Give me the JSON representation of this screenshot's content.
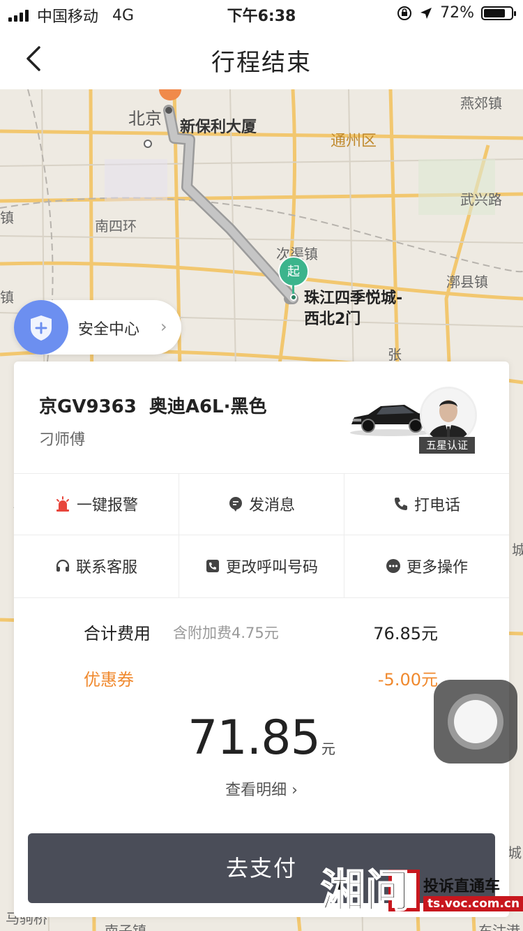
{
  "status_bar": {
    "carrier": "中国移动",
    "network": "4G",
    "time": "下午6:38",
    "battery": "72%"
  },
  "nav": {
    "title": "行程结束"
  },
  "map": {
    "labels": {
      "beijing": "北京",
      "xinbaoli": "新保利大厦",
      "tongzhou": "通州区",
      "yanjiao": "燕郊镇",
      "wuxing": "武兴路",
      "nansihuan": "南四环",
      "ciqu": "次渠镇",
      "xianxian": "漷县镇",
      "zhen_left": "镇",
      "zhen_left2": "镇",
      "zhang": "张",
      "cheng": "城",
      "dongcheng": "城",
      "majuqiao": "马驹桥",
      "nanzhen": "南子镇",
      "east": "东沽港"
    },
    "start_pin": "起",
    "destination": [
      "珠江四季悦城-",
      "西北2门"
    ]
  },
  "safety": {
    "label": "安全中心"
  },
  "driver": {
    "plate": "京GV9363",
    "car": "奥迪A6L·黑色",
    "name": "刁师傅",
    "badge": "五星认证"
  },
  "actions": [
    {
      "label": "一键报警",
      "icon": "alarm-icon"
    },
    {
      "label": "发消息",
      "icon": "message-icon"
    },
    {
      "label": "打电话",
      "icon": "phone-icon"
    },
    {
      "label": "联系客服",
      "icon": "headset-icon"
    },
    {
      "label": "更改呼叫号码",
      "icon": "phone-change-icon"
    },
    {
      "label": "更多操作",
      "icon": "more-icon"
    }
  ],
  "fees": {
    "total_label": "合计费用",
    "surcharge_note": "含附加费4.75元",
    "total_amount": "76.85元",
    "coupon_label": "优惠券",
    "coupon_amount": "-5.00元",
    "pay_amount": "71.85",
    "pay_unit": "元",
    "detail_link": "查看明细 ›"
  },
  "pay_button": "去支付",
  "watermark": {
    "brand": "湘问",
    "slogan": "投诉直通车",
    "url": "ts.voc.com.cn"
  },
  "colors": {
    "accent_orange": "#f0892e",
    "start_green": "#3cb48c",
    "pay_button": "#4a4d58",
    "alarm_red": "#e8463c"
  }
}
